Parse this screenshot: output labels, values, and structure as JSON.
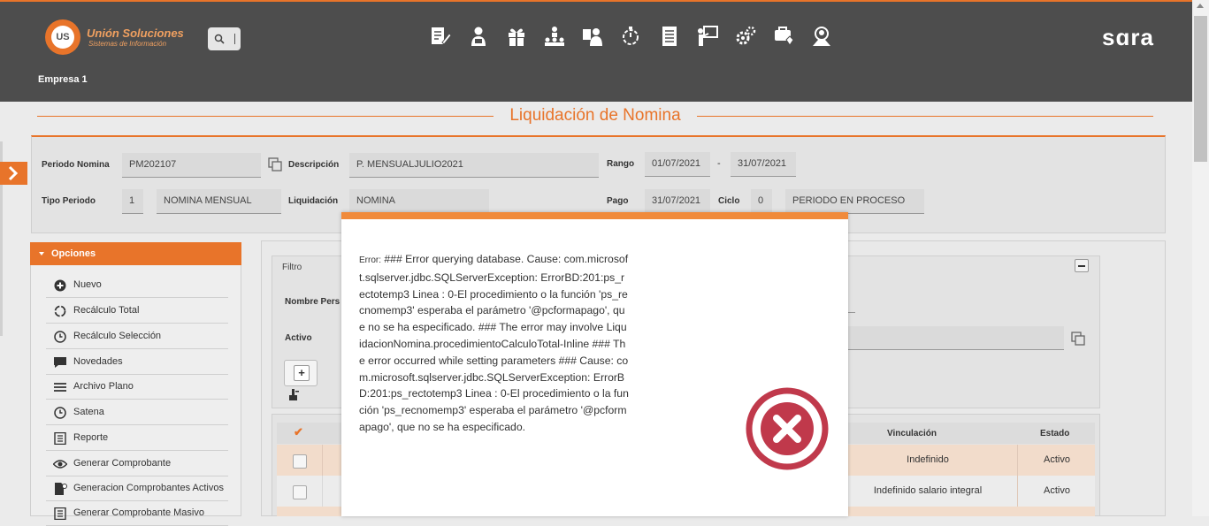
{
  "header": {
    "logo_mark": "Unión US",
    "logo_title": "Unión Soluciones",
    "logo_subtitle": "Sistemas de Información",
    "brand": "sɑra",
    "company": "Empresa 1",
    "nav_icons": [
      "document-edit-icon",
      "user-money-icon",
      "gift-icon",
      "org-chart-icon",
      "user-check-icon",
      "stopwatch-icon",
      "report-list-icon",
      "presentation-icon",
      "gears-icon",
      "shield-heart-icon",
      "user-network-icon"
    ]
  },
  "page": {
    "title": "Liquidación de Nomina"
  },
  "form": {
    "periodo_label": "Periodo Nomina",
    "periodo_value": "PM202107",
    "descripcion_label": "Descripción",
    "descripcion_value": "P. MENSUALJULIO2021",
    "rango_label": "Rango",
    "rango_desde": "01/07/2021",
    "rango_sep": "-",
    "rango_hasta": "31/07/2021",
    "tipo_label": "Tipo Periodo",
    "tipo_code": "1",
    "tipo_value": "NOMINA MENSUAL",
    "liquidacion_label": "Liquidación",
    "liquidacion_value": "NOMINA",
    "pago_label": "Pago",
    "pago_value": "31/07/2021",
    "ciclo_label": "Ciclo",
    "ciclo_value": "0",
    "estado_value": "PERIODO EN PROCESO"
  },
  "options": {
    "title": "Opciones",
    "items": [
      {
        "label": "Nuevo",
        "icon": "plus-circle-icon"
      },
      {
        "label": "Recálculo Total",
        "icon": "refresh-icon"
      },
      {
        "label": "Recálculo Selección",
        "icon": "clock-icon"
      },
      {
        "label": "Novedades",
        "icon": "comment-icon"
      },
      {
        "label": "Archivo Plano",
        "icon": "lines-icon"
      },
      {
        "label": "Satena",
        "icon": "clock-icon"
      },
      {
        "label": "Reporte",
        "icon": "list-doc-icon"
      },
      {
        "label": "Generar Comprobante",
        "icon": "eye-icon"
      },
      {
        "label": "Generacion Comprobantes Activos",
        "icon": "doc-gear-icon"
      },
      {
        "label": "Generar Comprobante Masivo",
        "icon": "list-doc-icon"
      }
    ]
  },
  "filter": {
    "title": "Filtro",
    "nombre_label": "Nombre Pers",
    "activo_label": "Activo",
    "add_symbol": "+"
  },
  "table": {
    "columns": [
      "Vinculación",
      "Estado"
    ],
    "rows": [
      {
        "vinculacion": "Indefinido",
        "estado": "Activo"
      },
      {
        "vinculacion": "Indefinido salario integral",
        "estado": "Activo"
      }
    ]
  },
  "modal": {
    "error_label": "Error:",
    "message": "### Error querying database. Cause: com.microsoft.sqlserver.jdbc.SQLServerException: ErrorBD:201:ps_rectotemp3 Linea : 0-El procedimiento o la función 'ps_recnomemp3' esperaba el parámetro '@pcformapago', que no se ha especificado. ### The error may involve LiquidacionNomina.procedimientoCalculoTotal-Inline ### The error occurred while setting parameters ### Cause: com.microsoft.sqlserver.jdbc.SQLServerException: ErrorBD:201:ps_rectotemp3 Linea : 0-El procedimiento o la función 'ps_recnomemp3' esperaba el parámetro '@pcformapago', que no se ha especificado."
  },
  "colors": {
    "accent": "#e8742a",
    "header_bg": "#4d4d4d",
    "error_red": "#c0394b",
    "row_highlight": "#f2dccb"
  }
}
